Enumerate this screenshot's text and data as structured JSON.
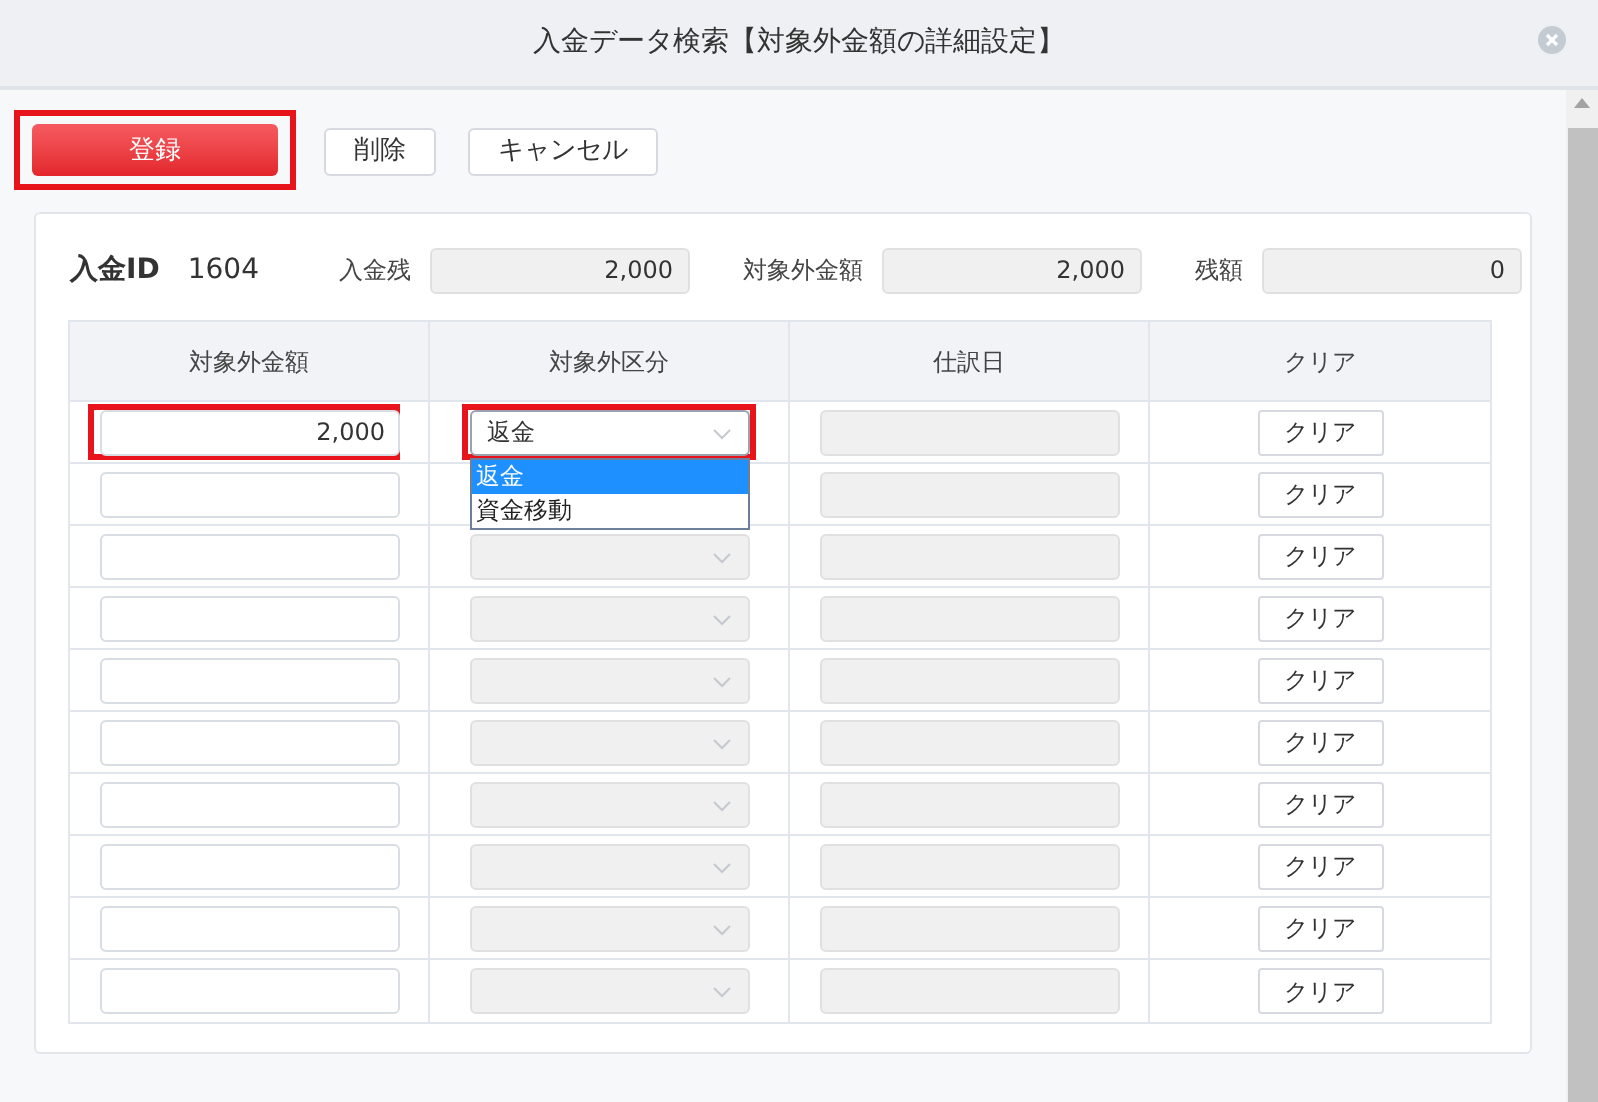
{
  "dialog": {
    "title": "入金データ検索【対象外金額の詳細設定】"
  },
  "toolbar": [
    {
      "label": "登録",
      "kind": "primary",
      "highlighted": true
    },
    {
      "label": "削除",
      "kind": "default",
      "highlighted": false
    },
    {
      "label": "キャンセル",
      "kind": "default",
      "highlighted": false
    }
  ],
  "summary": {
    "id_label": "入金ID",
    "id_value": "1604",
    "fields": [
      {
        "label": "入金残",
        "value": "2,000"
      },
      {
        "label": "対象外金額",
        "value": "2,000"
      },
      {
        "label": "残額",
        "value": "0"
      }
    ]
  },
  "table": {
    "columns": [
      "対象外金額",
      "対象外区分",
      "仕訳日",
      "クリア"
    ],
    "rows": [
      {
        "amount": "2,000",
        "category": "返金",
        "highlighted": true,
        "clear": "クリア",
        "category_options": [
          {
            "label": "返金",
            "selected": true
          },
          {
            "label": "資金移動",
            "selected": false
          }
        ]
      },
      {
        "highlighted": false,
        "clear": "クリア"
      },
      {
        "highlighted": false,
        "clear": "クリア"
      },
      {
        "highlighted": false,
        "clear": "クリア"
      },
      {
        "highlighted": false,
        "clear": "クリア"
      },
      {
        "highlighted": false,
        "clear": "クリア"
      },
      {
        "highlighted": false,
        "clear": "クリア"
      },
      {
        "highlighted": false,
        "clear": "クリア"
      },
      {
        "highlighted": false,
        "clear": "クリア"
      },
      {
        "highlighted": false,
        "clear": "クリア"
      }
    ]
  }
}
